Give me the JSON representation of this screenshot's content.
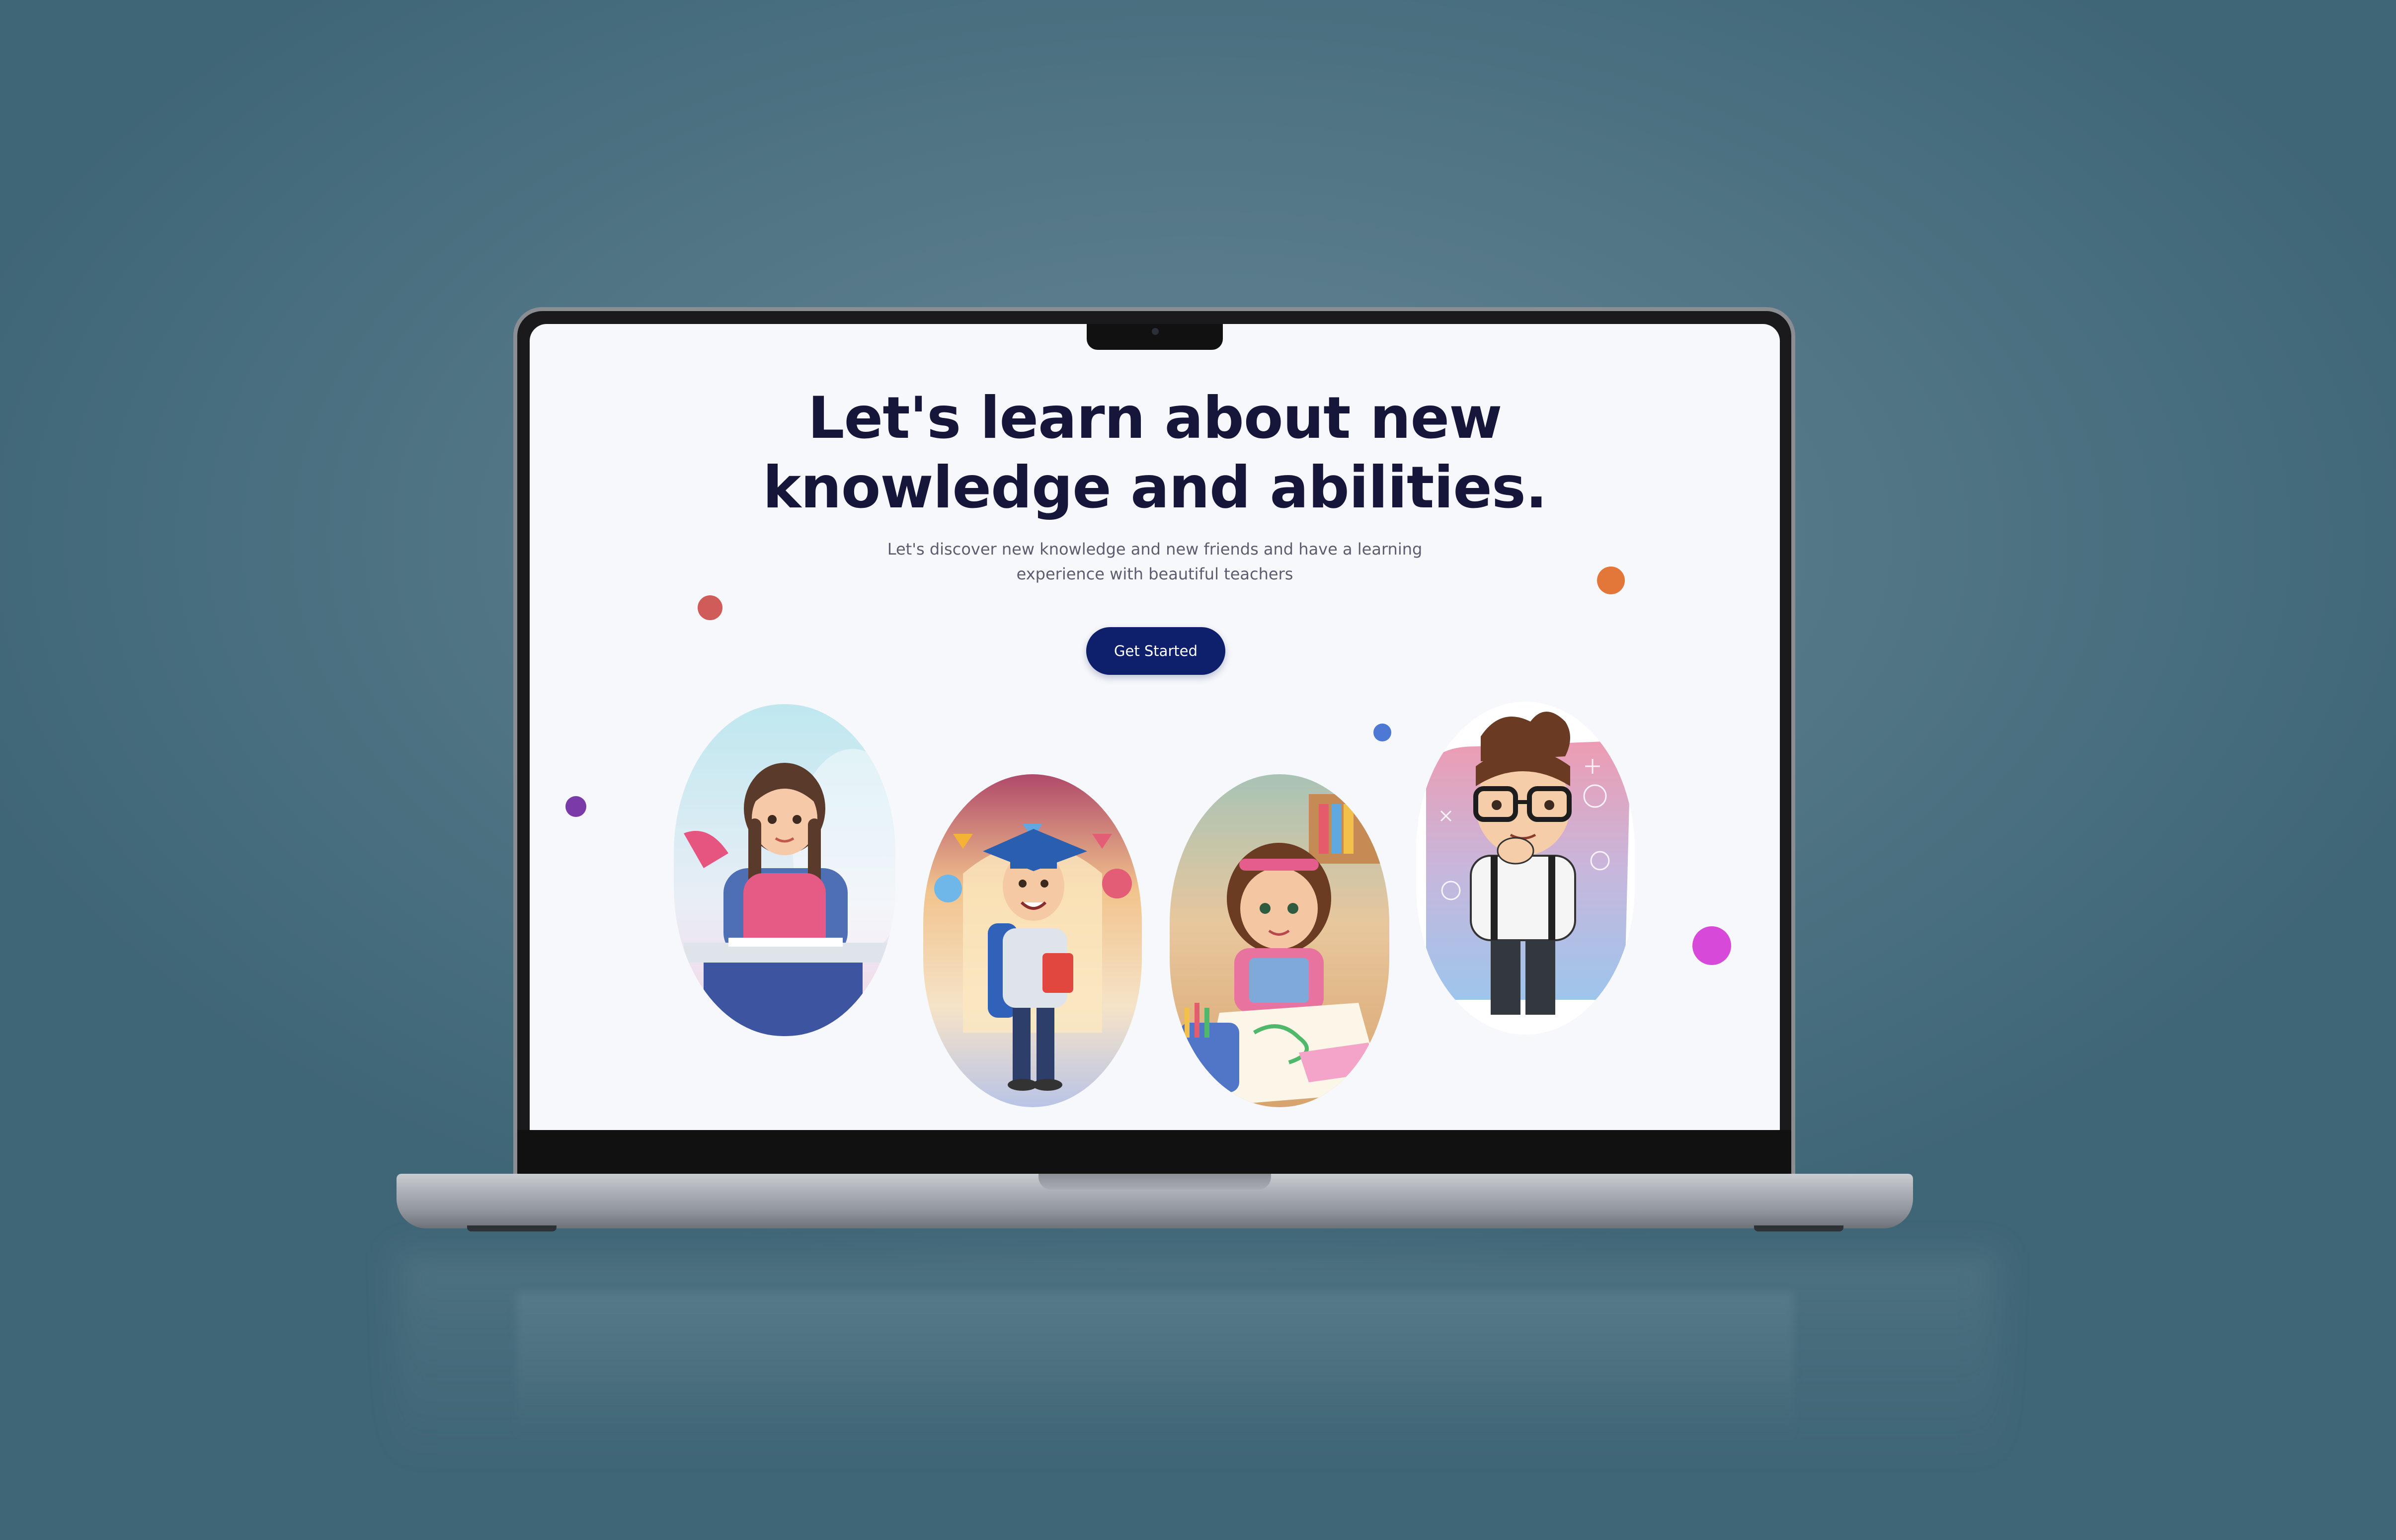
{
  "hero": {
    "headline_line1": "Let's learn about new",
    "headline_line2": "knowledge and abilities.",
    "subtitle_line1": "Let's discover new knowledge and new friends and have a learning",
    "subtitle_line2": "experience with beautiful teachers",
    "cta_label": "Get Started"
  },
  "colors": {
    "headline": "#16153a",
    "cta_bg": "#0e1f6b",
    "dot_red": "#cf5c58",
    "dot_orange": "#e3773a",
    "dot_purple": "#7a3aa8",
    "dot_blue": "#4d78d4",
    "dot_magenta": "#d74ad9"
  },
  "gallery": [
    {
      "name": "girl-reading-card"
    },
    {
      "name": "graduate-boy-card"
    },
    {
      "name": "girl-drawing-card"
    },
    {
      "name": "boy-with-glasses-card"
    }
  ]
}
